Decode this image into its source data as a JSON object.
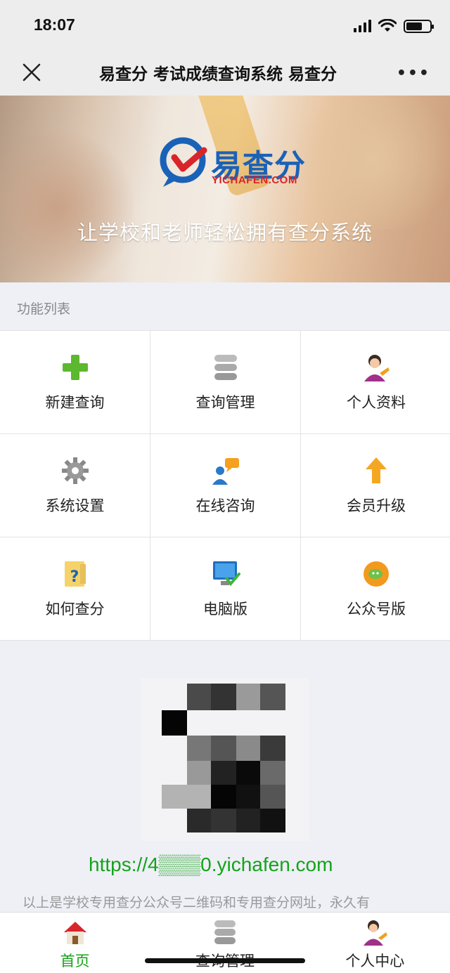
{
  "status": {
    "time": "18:07"
  },
  "titlebar": {
    "title": "易查分 考试成绩查询系统 易查分",
    "close_icon": "close-icon",
    "more": "•••"
  },
  "banner": {
    "logo_text": "易查分",
    "logo_sub": "YICHAFEN.COM",
    "slogan": "让学校和老师轻松拥有查分系统"
  },
  "section": {
    "label": "功能列表"
  },
  "grid": [
    {
      "label": "新建查询",
      "icon": "plus-icon"
    },
    {
      "label": "查询管理",
      "icon": "database-icon"
    },
    {
      "label": "个人资料",
      "icon": "user-icon"
    },
    {
      "label": "系统设置",
      "icon": "gear-icon"
    },
    {
      "label": "在线咨询",
      "icon": "chat-user-icon"
    },
    {
      "label": "会员升级",
      "icon": "arrow-up-icon"
    },
    {
      "label": "如何查分",
      "icon": "help-icon"
    },
    {
      "label": "电脑版",
      "icon": "monitor-icon"
    },
    {
      "label": "公众号版",
      "icon": "wechat-icon"
    }
  ],
  "qr": {
    "url": "https://4▒▒▒0.yichafen.com",
    "desc": "以上是学校专用查分公众号二维码和专用查分网址，永久有"
  },
  "tabbar": [
    {
      "label": "首页",
      "icon": "home-icon",
      "active": true
    },
    {
      "label": "查询管理",
      "icon": "database-icon",
      "active": false
    },
    {
      "label": "个人中心",
      "icon": "user-icon",
      "active": false
    }
  ],
  "colors": {
    "accent": "#15a31a",
    "brand_blue": "#1a62b8",
    "brand_red": "#d8252a"
  }
}
